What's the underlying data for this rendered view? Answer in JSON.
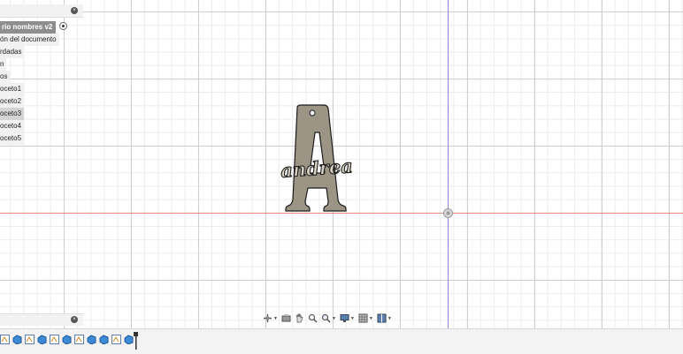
{
  "browser": {
    "root_label": "rio nombres v2",
    "items": [
      {
        "label": "ón del documento",
        "selected": false
      },
      {
        "label": "rdadas",
        "selected": false
      },
      {
        "label": "n",
        "selected": false
      },
      {
        "label": "os",
        "selected": false
      },
      {
        "label": "oceto1",
        "selected": false
      },
      {
        "label": "oceto2",
        "selected": false
      },
      {
        "label": "oceto3",
        "selected": true
      },
      {
        "label": "oceto4",
        "selected": false
      },
      {
        "label": "oceto5",
        "selected": false
      }
    ]
  },
  "model": {
    "letter": "A",
    "name_text": "andrea",
    "fill_color": "#9c9485",
    "outline_color": "#1c1c1c"
  },
  "axes": {
    "x_axis_color": "#e58a7a",
    "y_axis_color": "#8a87e0"
  },
  "nav_toolbar": {
    "icons": [
      "orbit-icon",
      "look-at-icon",
      "pan-icon",
      "zoom-window-icon",
      "zoom-icon",
      "display-settings-icon",
      "grid-icon",
      "viewports-icon"
    ]
  },
  "timeline": {
    "items": [
      "sketch",
      "extrude",
      "sketch",
      "extrude",
      "sketch",
      "extrude",
      "sketch",
      "extrude",
      "extrude",
      "sketch",
      "extrude"
    ]
  }
}
